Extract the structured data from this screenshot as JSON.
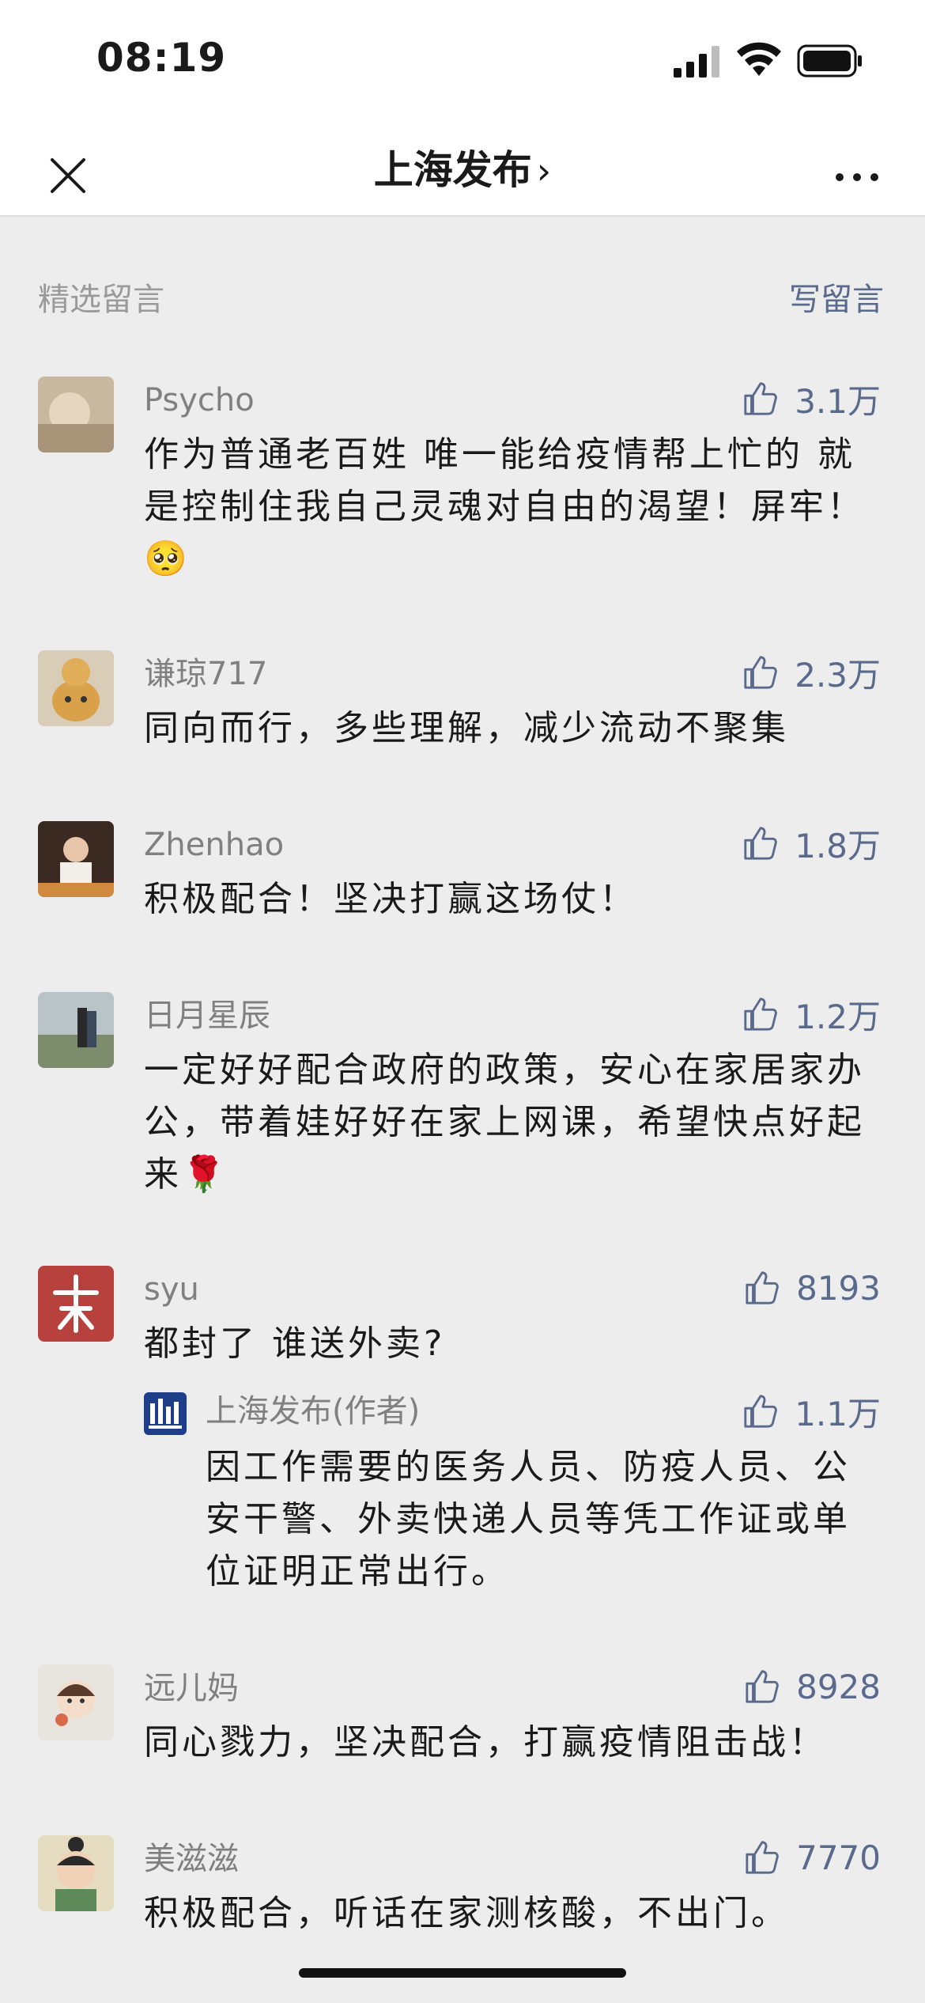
{
  "status": {
    "time": "08:19"
  },
  "nav": {
    "title": "上海发布",
    "chevron": "›"
  },
  "section": {
    "label": "精选留言",
    "write_link": "写留言"
  },
  "comments": [
    {
      "name": "Psycho",
      "likes": "3.1万",
      "text": "作为普通老百姓 唯一能给疫情帮上忙的 就是控制住我自己灵魂对自由的渴望！屏牢！",
      "emoji": "🥺"
    },
    {
      "name": "谦琼717",
      "likes": "2.3万",
      "text": "同向而行，多些理解，减少流动不聚集"
    },
    {
      "name": "Zhenhao",
      "likes": "1.8万",
      "text": "积极配合！坚决打赢这场仗！"
    },
    {
      "name": "日月星辰",
      "likes": "1.2万",
      "text": "一定好好配合政府的政策，安心在家居家办公，带着娃好好在家上网课，希望快点好起来",
      "emoji": "🌹"
    },
    {
      "name": "syu",
      "likes": "8193",
      "text": "都封了 谁送外卖?",
      "reply": {
        "name": "上海发布(作者)",
        "likes": "1.1万",
        "text": "因工作需要的医务人员、防疫人员、公安干警、外卖快递人员等凭工作证或单位证明正常出行。"
      }
    },
    {
      "name": "远儿妈",
      "likes": "8928",
      "text": "同心戮力，坚决配合，打赢疫情阻击战！"
    },
    {
      "name": "美滋滋",
      "likes": "7770",
      "text": "积极配合，听话在家测核酸，不出门。"
    }
  ],
  "icons": {
    "like": "thumbs-up-icon",
    "close": "close-icon",
    "more": "more-icon"
  },
  "colors": {
    "link": "#5a6a8c",
    "muted": "#808080",
    "background": "#ededed"
  }
}
